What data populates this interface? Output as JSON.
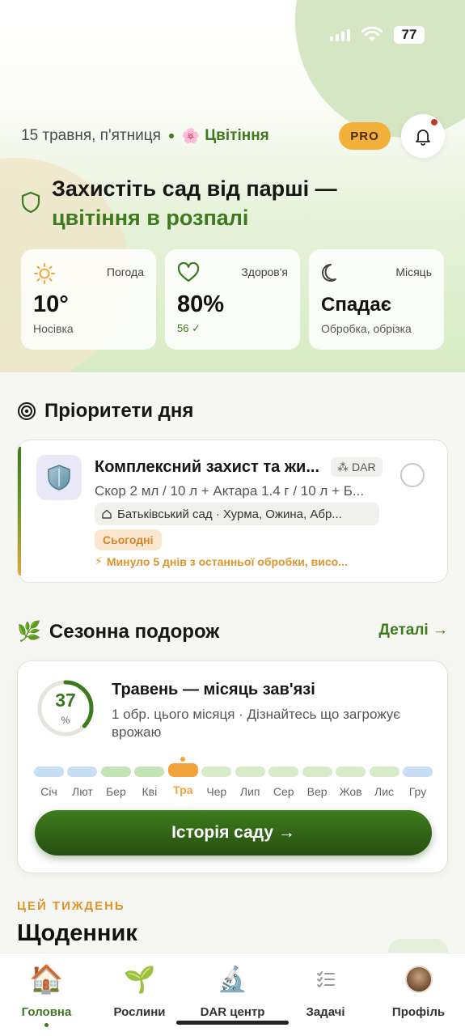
{
  "status_bar": {
    "battery": "77"
  },
  "header": {
    "date": "15 травня, п'ятниця",
    "season": "Цвітіння",
    "season_icon": "flower-icon",
    "pro_label": "PRO",
    "notifications_icon": "bell-icon"
  },
  "headline": {
    "line1": "Захистіть сад від парші —",
    "line2": "цвітіння в розпалі"
  },
  "stats": [
    {
      "label": "Погода",
      "value": "10°",
      "sub": "Носівка",
      "icon": "sun-icon"
    },
    {
      "label": "Здоров'я",
      "value": "80%",
      "sub": "56 ✓",
      "icon": "heart-icon"
    },
    {
      "label": "Місяць",
      "value": "Спадає",
      "sub": "Обробка, обрізка",
      "icon": "moon-icon"
    }
  ],
  "priorities": {
    "title": "Пріоритети дня",
    "task": {
      "title": "Комплексний захист та жи...",
      "dar_label": "DAR",
      "description": "Скор 2 мл / 10 л + Актара 1.4 г / 10 л + Б...",
      "location": "Батьківський сад · Хурма, Ожина, Абр...",
      "due": "Сьогодні",
      "warning": "Минуло 5 днів з останньої обробки, висо..."
    }
  },
  "journey": {
    "title": "Сезонна подорож",
    "details_link": "Деталі →",
    "progress_value": "37",
    "progress_unit": "%",
    "progress_fraction": 0.37,
    "card_title": "Травень — місяць зав'язі",
    "card_text": "1 обр. цього місяця · Дізнайтесь що загрожує врожаю",
    "months": [
      {
        "label": "Січ",
        "color": "#c9def5"
      },
      {
        "label": "Лют",
        "color": "#c9def5"
      },
      {
        "label": "Бер",
        "color": "#c4e4b6"
      },
      {
        "label": "Кві",
        "color": "#c4e4b6"
      },
      {
        "label": "Тра",
        "color": "#f2a43a",
        "current": true
      },
      {
        "label": "Чер",
        "color": "#d7ebc8"
      },
      {
        "label": "Лип",
        "color": "#d7ebc8"
      },
      {
        "label": "Сер",
        "color": "#d7ebc8"
      },
      {
        "label": "Вер",
        "color": "#d7ebc8"
      },
      {
        "label": "Жов",
        "color": "#d7ebc8"
      },
      {
        "label": "Лис",
        "color": "#d7ebc8"
      },
      {
        "label": "Гру",
        "color": "#c9def5"
      }
    ],
    "button_label": "Історія саду →"
  },
  "week": {
    "label": "ЦЕЙ ТИЖДЕНЬ",
    "title": "Щоденник"
  },
  "tabs": [
    {
      "label": "Головна",
      "icon": "house-icon",
      "active": true
    },
    {
      "label": "Рослини",
      "icon": "sprout-icon"
    },
    {
      "label": "DAR центр",
      "icon": "microscope-icon"
    },
    {
      "label": "Задачі",
      "icon": "checklist-icon"
    },
    {
      "label": "Профіль",
      "icon": "avatar-icon"
    }
  ],
  "colors": {
    "brand_green": "#3d7a1f",
    "accent_orange": "#f2b13a",
    "warning_orange": "#e0952c"
  }
}
